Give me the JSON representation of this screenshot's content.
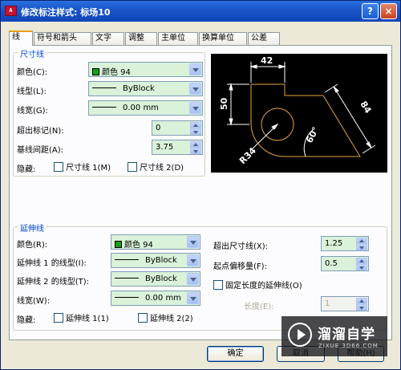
{
  "window": {
    "title": "修改标注样式: 标场10",
    "icon_text": "A",
    "help_glyph": "?",
    "close_glyph": "×"
  },
  "tabs": [
    {
      "label": "线",
      "active": true
    },
    {
      "label": "符号和箭头"
    },
    {
      "label": "文字"
    },
    {
      "label": "调整"
    },
    {
      "label": "主单位"
    },
    {
      "label": "换算单位"
    },
    {
      "label": "公差"
    }
  ],
  "dim_lines": {
    "group_label": "尺寸线",
    "color_label": "颜色(C):",
    "color_value": "颜色 94",
    "linetype_label": "线型(L):",
    "linetype_value": "ByBlock",
    "lineweight_label": "线宽(G):",
    "lineweight_value": "0.00 mm",
    "extend_label": "超出标记(N):",
    "extend_value": "0",
    "baseline_label": "基线间距(A):",
    "baseline_value": "3.75",
    "suppress_label": "隐藏:",
    "suppress_1": "尺寸线 1(M)",
    "suppress_2": "尺寸线 2(D)"
  },
  "ext_lines": {
    "group_label": "延伸线",
    "color_label": "颜色(R):",
    "color_value": "颜色 94",
    "linetype1_label": "延伸线 1 的线型(I):",
    "linetype1_value": "ByBlock",
    "linetype2_label": "延伸线 2 的线型(T):",
    "linetype2_value": "ByBlock",
    "lineweight_label": "线宽(W):",
    "lineweight_value": "0.00 mm",
    "suppress_label": "隐藏:",
    "suppress_1": "延伸线 1(1)",
    "suppress_2": "延伸线 2(2)",
    "beyond_label": "超出尺寸线(X):",
    "beyond_value": "1.25",
    "offset_label": "起点偏移量(F):",
    "offset_value": "0.5",
    "fixed_label": "固定长度的延伸线(O)",
    "length_label": "长度(E):",
    "length_value": "1"
  },
  "preview": {
    "dim_42": "42",
    "dim_50": "50",
    "dim_84": "84",
    "dim_60": "60°",
    "dim_r34": "R34"
  },
  "buttons": {
    "ok": "确定",
    "cancel": "取消",
    "help": "帮助(H)"
  },
  "watermark": {
    "title": "溜溜自学",
    "subtitle": "ZIXUE.3D66.COM"
  },
  "colors": {
    "title_bar": "#0f45b8",
    "preview_bg": "#000000",
    "preview_geometry": "#e8a33c",
    "dimension": "#ffffff",
    "combo_bg": "#d9f2d9",
    "swatch": "#18a018"
  }
}
